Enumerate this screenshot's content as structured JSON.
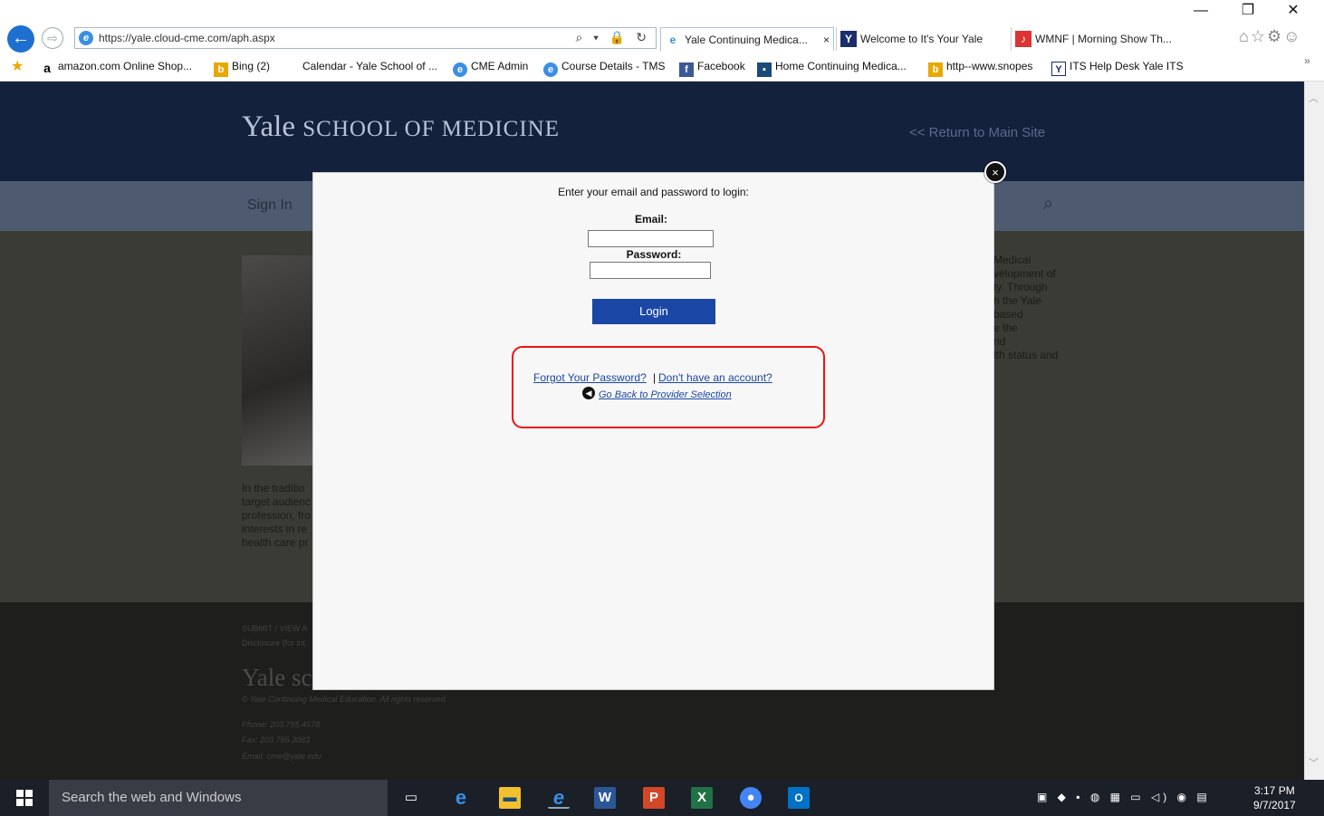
{
  "window": {
    "minimize": "—",
    "restore": "❐",
    "close": "✕"
  },
  "address_bar": {
    "url": "https://yale.cloud-cme.com/aph.aspx",
    "tools": "⌕ ▾ 🔒 ↻"
  },
  "tabs": [
    {
      "label": "Yale Continuing Medica...",
      "close": "×"
    },
    {
      "label": "Welcome to It's Your Yale"
    },
    {
      "label": "WMNF | Morning Show Th..."
    }
  ],
  "right_icons": "⌂☆⚙☺",
  "favorites": [
    {
      "label": "amazon.com Online Shop...",
      "icon": "a"
    },
    {
      "label": "Bing (2)",
      "icon": "b"
    },
    {
      "label": "Calendar - Yale School of ...",
      "icon": ""
    },
    {
      "label": "CME Admin",
      "icon": "e"
    },
    {
      "label": "Course Details - TMS",
      "icon": "e"
    },
    {
      "label": "Facebook",
      "icon": "f"
    },
    {
      "label": "Home  Continuing Medica...",
      "icon": "▪"
    },
    {
      "label": "http--www.snopes",
      "icon": "b"
    },
    {
      "label": "ITS Help Desk  Yale ITS",
      "icon": "Y"
    }
  ],
  "site": {
    "logo_main": "Yale",
    "logo_sub": "SCHOOL OF MEDICINE",
    "return_link": "<< Return to Main Site",
    "nav_signin": "Sign In",
    "right_text": [
      "Medical",
      "velopment of",
      "ty. Through",
      "h the Yale",
      "based",
      "e the",
      "nd",
      "lth status and"
    ],
    "left_text": [
      "In the traditio",
      "target audienc",
      "profession, fro",
      "interests in re",
      "health care pr"
    ],
    "footer_submit": "SUBMIT / VIEW A",
    "footer_disclosure": "Disclosure (for int",
    "footer_logo": "Yale sc",
    "footer_copyright": "© Yale Continuing Medical Education. All rights reserved.",
    "footer_phone": "Phone: 203.785.4578",
    "footer_fax": "Fax: 203.785.3083",
    "footer_email": "Email: cme@yale.edu"
  },
  "modal": {
    "prompt": "Enter your email and password to login:",
    "email_label": "Email:",
    "password_label": "Password:",
    "login_button": "Login",
    "forgot_link": "Forgot Your Password?",
    "separator": "|",
    "no_account_link": "Don't have an account?",
    "go_back_link": "Go Back to Provider Selection",
    "close": "×"
  },
  "taskbar": {
    "search_placeholder": "Search the web and Windows",
    "time": "3:17 PM",
    "date": "9/7/2017"
  },
  "colors": {
    "accent": "#1b47a6",
    "highlight": "#ee1111",
    "header": "#14213d"
  }
}
